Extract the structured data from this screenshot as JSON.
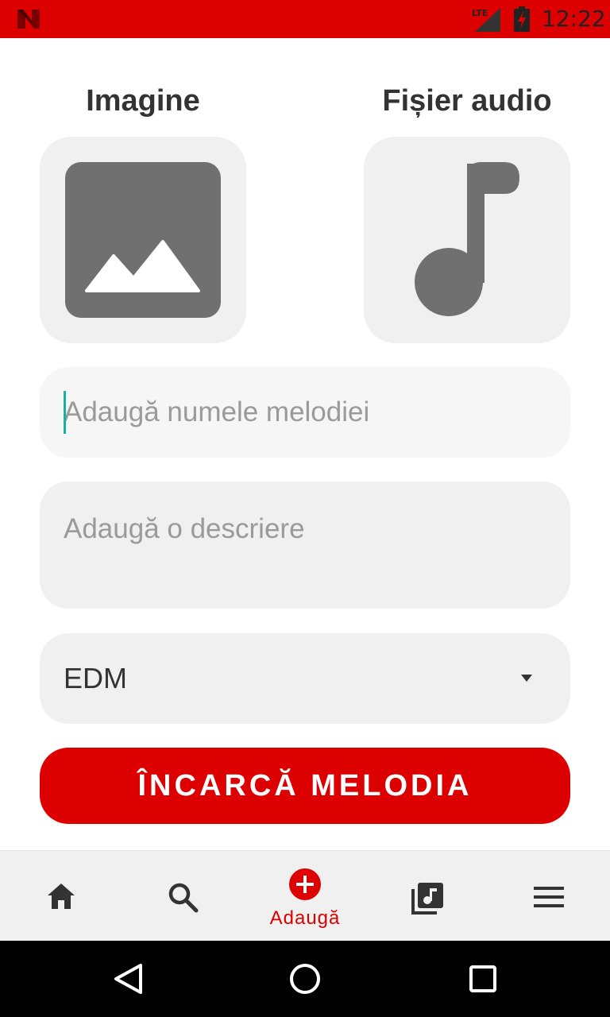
{
  "status_bar": {
    "time": "12:22",
    "network": "LTE",
    "background_color": "#dd0000",
    "icons": [
      "app-logo-icon",
      "lte-signal-icon",
      "battery-charging-icon"
    ]
  },
  "pickers": {
    "image_label": "Imagine",
    "audio_label": "Fișier audio",
    "image_icon": "image-icon",
    "audio_icon": "music-note-icon"
  },
  "form": {
    "song_name_placeholder": "Adaugă numele melodiei",
    "song_name_value": "",
    "description_placeholder": "Adaugă o descriere",
    "description_value": "",
    "genre_selected": "EDM",
    "upload_label": "ÎNCARCĂ MELODIA"
  },
  "bottom_nav": {
    "items": [
      {
        "icon": "home-icon",
        "label": ""
      },
      {
        "icon": "search-icon",
        "label": ""
      },
      {
        "icon": "add-circle-icon",
        "label": "Adaugă",
        "active": true
      },
      {
        "icon": "library-music-icon",
        "label": ""
      },
      {
        "icon": "menu-icon",
        "label": ""
      }
    ]
  },
  "system_nav": {
    "icons": [
      "back-icon",
      "home-circle-icon",
      "recents-icon"
    ]
  },
  "colors": {
    "accent": "#dd0000",
    "tile_background": "#f0f0f0",
    "icon_gray": "#707070",
    "caret": "#1ab0a0"
  }
}
